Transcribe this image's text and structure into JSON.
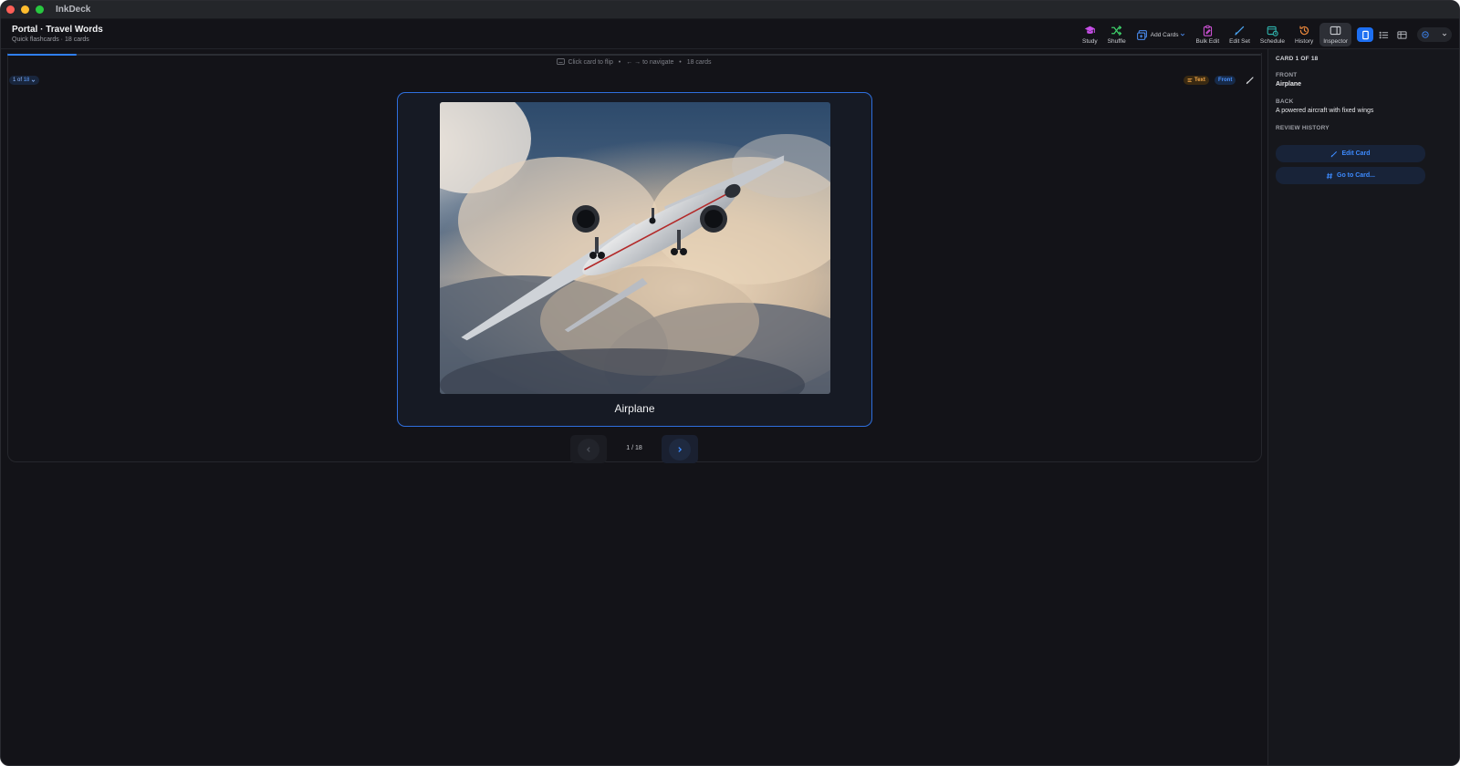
{
  "window": {
    "app_title": "InkDeck"
  },
  "header": {
    "title": "Portal · Travel Words",
    "subtitle": "Quick flashcards · 18 cards"
  },
  "toolbar": {
    "study": "Study",
    "shuffle": "Shuffle",
    "add_cards": "Add Cards",
    "bulk_edit": "Bulk Edit",
    "edit_set": "Edit Set",
    "schedule": "Schedule",
    "history": "History",
    "inspector": "Inspector"
  },
  "progress": {
    "fraction": 0.0556
  },
  "hint": {
    "flip": "Click card to flip",
    "navigate": "← → to navigate",
    "count": "18 cards"
  },
  "card_counter": {
    "current": "1 of",
    "total": "18"
  },
  "badges": {
    "text": "Text",
    "front": "Front"
  },
  "card": {
    "label": "Airplane",
    "image": "airplane-photo"
  },
  "pager": {
    "indicator": "1 / 18"
  },
  "inspector": {
    "heading": "CARD 1 OF 18",
    "front_label": "FRONT",
    "front_value": "Airplane",
    "back_label": "BACK",
    "back_value": "A powered aircraft with fixed wings",
    "history_label": "REVIEW HISTORY",
    "edit_button": "Edit Card",
    "goto_button": "Go to Card..."
  },
  "colors": {
    "accent": "#2f7ff5",
    "study": "#c74ee8",
    "shuffle": "#3ecf6a",
    "add_cards": "#4a8cf0",
    "bulk_edit": "#d152d9",
    "edit_set": "#4aa3f0",
    "schedule": "#2fb6b0",
    "history": "#f08a3c",
    "badge_text": "#f5a94a",
    "badge_front": "#4a92ff"
  }
}
